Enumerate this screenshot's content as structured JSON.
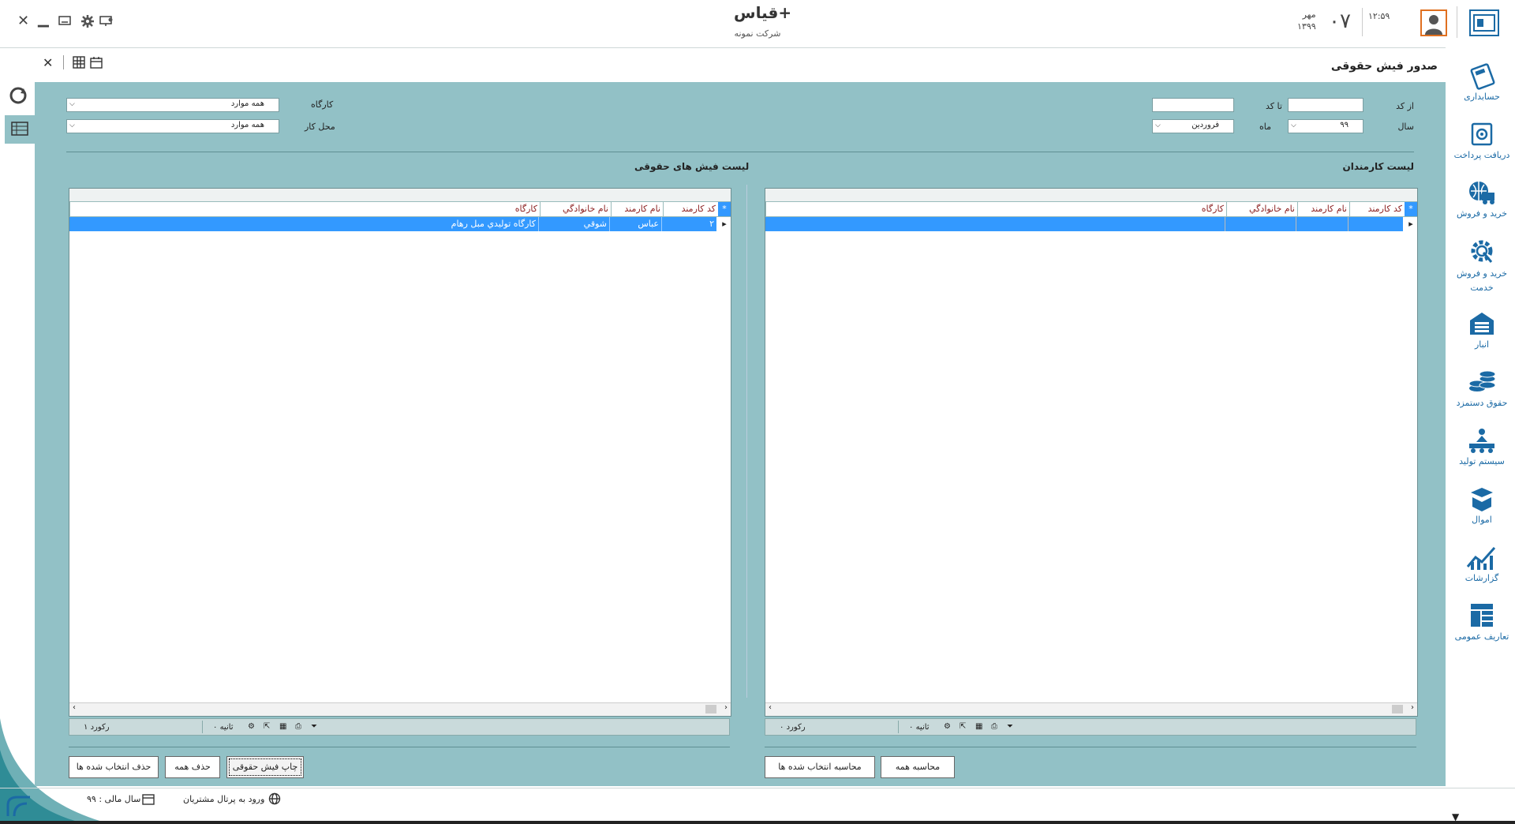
{
  "header": {
    "app_title": "قیاس+",
    "company": "شرکت نمونه",
    "time": "۱۲:۵۹",
    "day": "۰۷",
    "month": "مهر",
    "year": "۱۳۹۹"
  },
  "page": {
    "title": "صدور فیش حقوقی"
  },
  "sidebar": {
    "items": [
      {
        "label": "حسابداری",
        "icon": "calculator-icon"
      },
      {
        "label": "دریافت پرداخت",
        "icon": "safe-icon"
      },
      {
        "label": "خرید و فروش",
        "icon": "globe-truck-icon"
      },
      {
        "label": "خرید و فروش خدمت",
        "icon": "gear-service-icon"
      },
      {
        "label": "انبار",
        "icon": "warehouse-icon"
      },
      {
        "label": "حقوق دستمزد",
        "icon": "coins-icon"
      },
      {
        "label": "سیستم تولید",
        "icon": "production-icon"
      },
      {
        "label": "اموال",
        "icon": "box-icon"
      },
      {
        "label": "گزارشات",
        "icon": "chart-icon"
      },
      {
        "label": "تعاریف عمومی",
        "icon": "layout-icon"
      }
    ]
  },
  "filters": {
    "from_code_label": "از کد",
    "to_code_label": "تا کد",
    "from_code_value": "",
    "to_code_value": "",
    "year_label": "سال",
    "year_value": "۹۹",
    "month_label": "ماه",
    "month_value": "فروردین",
    "workshop_label": "کارگاه",
    "workshop_value": "همه موارد",
    "workplace_label": "محل کار",
    "workplace_value": "همه موارد"
  },
  "employees": {
    "title": "لیست کارمندان",
    "columns": [
      "کد کارمند",
      "نام کارمند",
      "نام خانوادگي",
      "كارگاه"
    ],
    "rows": [],
    "records": "۰ رکورد",
    "seconds": "۰ ثانیه",
    "btn_calc_all": "محاسبه همه",
    "btn_calc_selected": "محاسبه انتخاب شده ها"
  },
  "payslips": {
    "title": "لیست فیش های حقوقی",
    "columns": [
      "کد کارمند",
      "نام کارمند",
      "نام خانوادگي",
      "كارگاه"
    ],
    "rows": [
      {
        "code": "۲",
        "name": "عباس",
        "family": "شوقي",
        "workshop": "كارگاه توليدي مبل رهام"
      }
    ],
    "records": "۱ رکورد",
    "seconds": "۰ ثانیه",
    "btn_print": "چاپ فیش حقوقی",
    "btn_delete_all": "حذف همه",
    "btn_delete_selected": "حذف انتخاب شده ها"
  },
  "status": {
    "portal": "ورود به پرتال مشتریان",
    "fiscal_year": "سال مالی : ۹۹"
  },
  "colors": {
    "panel": "#92c1c6",
    "selected_row": "#3399ff",
    "header_text": "#8b1e1e",
    "sidebar_text": "#1b6aa5"
  }
}
